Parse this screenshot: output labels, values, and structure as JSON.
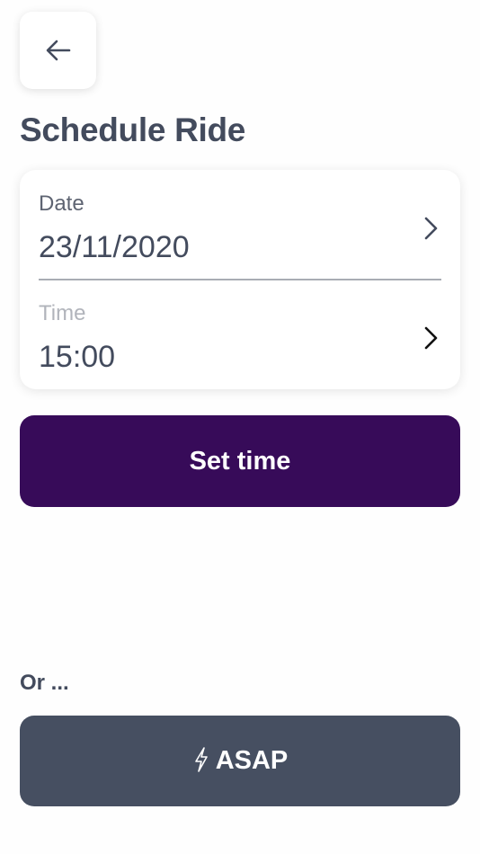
{
  "header": {
    "back_icon": "arrow-left-icon",
    "title": "Schedule Ride"
  },
  "schedule": {
    "date": {
      "label": "Date",
      "value": "23/11/2020",
      "icon": "chevron-right-icon"
    },
    "time": {
      "label": "Time",
      "value": "15:00",
      "icon": "chevron-right-icon"
    }
  },
  "actions": {
    "set_time_label": "Set time",
    "or_text": "Or ...",
    "asap_label": "ASAP",
    "asap_icon": "lightning-bolt-icon"
  },
  "colors": {
    "primary": "#370b59",
    "secondary": "#464f61",
    "text": "#434b5d"
  }
}
